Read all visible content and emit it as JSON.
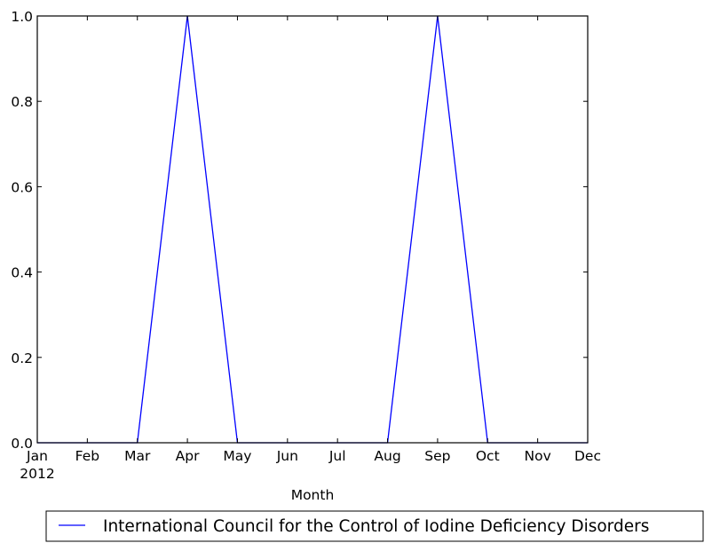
{
  "chart_data": {
    "type": "line",
    "title": "",
    "xlabel": "Month",
    "ylabel": "",
    "x": [
      "Jan",
      "Feb",
      "Mar",
      "Apr",
      "May",
      "Jun",
      "Jul",
      "Aug",
      "Sep",
      "Oct",
      "Nov",
      "Dec"
    ],
    "x_year_label": "2012",
    "series": [
      {
        "name": "International Council for the Control of Iodine Deficiency Disorders",
        "color": "#0000ff",
        "values": [
          0,
          0,
          0,
          1,
          0,
          0,
          0,
          0,
          1,
          0,
          0,
          0
        ]
      }
    ],
    "ylim": [
      0.0,
      1.0
    ],
    "yticks": [
      "0.0",
      "0.2",
      "0.4",
      "0.6",
      "0.8",
      "1.0"
    ],
    "grid": false,
    "legend_position": "bottom-center, below axes"
  }
}
